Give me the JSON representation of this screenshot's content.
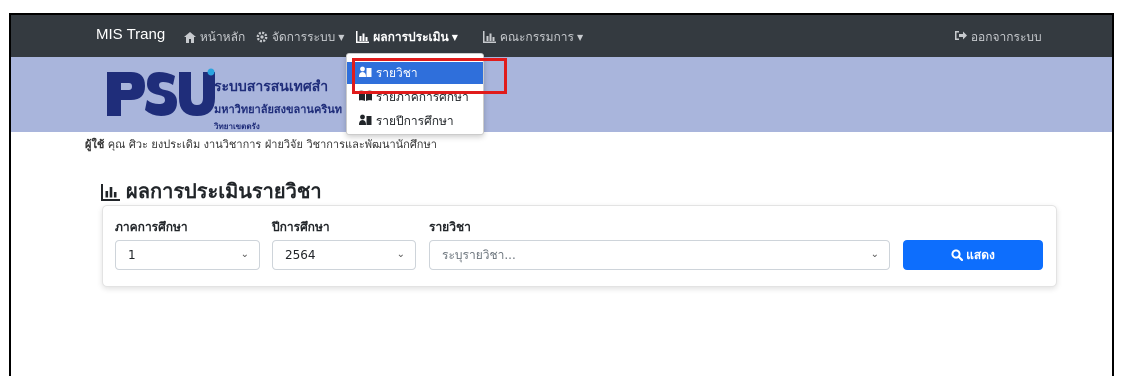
{
  "navbar": {
    "brand": "MIS Trang",
    "items": [
      {
        "label": "หน้าหลัก",
        "icon": "home-icon",
        "caret": false
      },
      {
        "label": "จัดการระบบ",
        "icon": "gear-icon",
        "caret": true
      },
      {
        "label": "ผลการประเมิน",
        "icon": "chart-icon",
        "caret": true,
        "active": true
      },
      {
        "label": "คณะกรรมการ",
        "icon": "chart-icon",
        "caret": true
      }
    ],
    "logout": "ออกจากระบบ"
  },
  "banner": {
    "logo_letters": "PSU",
    "line1": "ระบบสารสนเทศสำ",
    "line2": "มหาวิทยาลัยสงขลานครินท",
    "line3": "วิทยาเขตตรัง"
  },
  "dropdown": {
    "items": [
      {
        "label": "รายวิชา",
        "icon": "user-book-icon",
        "active": true
      },
      {
        "label": "รายภาคการศึกษา",
        "icon": "book-icon",
        "active": false
      },
      {
        "label": "รายปีการศึกษา",
        "icon": "user-book-icon",
        "active": false
      }
    ]
  },
  "user": {
    "prefix": "ผู้ใช้",
    "text": "คุณ ศิวะ ยงประเดิม งานวิชาการ ฝ่ายวิจัย วิชาการและพัฒนานักศึกษา"
  },
  "page": {
    "title": "ผลการประเมินรายวิชา"
  },
  "form": {
    "semester_label": "ภาคการศึกษา",
    "semester_value": "1",
    "year_label": "ปีการศึกษา",
    "year_value": "2564",
    "course_label": "รายวิชา",
    "course_placeholder": "ระบุรายวิชา...",
    "show_button": "แสดง"
  },
  "colors": {
    "navbar_bg": "#343a40",
    "banner_bg": "#a9b5dc",
    "accent": "#0d6efd",
    "highlight": "#e01b1b"
  }
}
